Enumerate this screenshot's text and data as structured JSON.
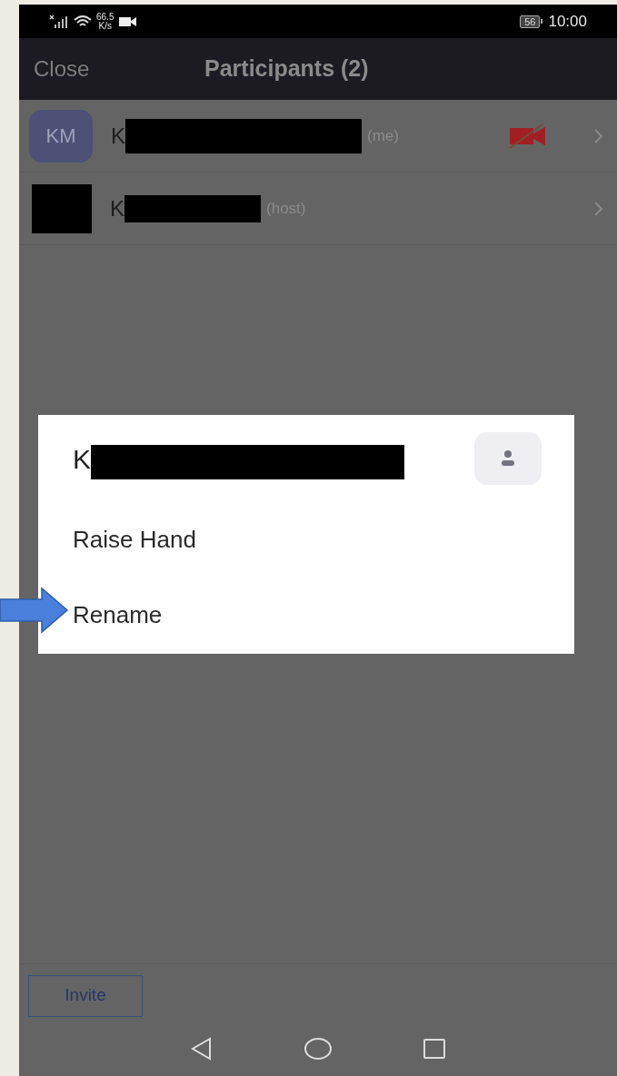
{
  "status_bar": {
    "speed_value": "66.5",
    "speed_unit": "K/s",
    "battery": "56",
    "time": "10:00"
  },
  "header": {
    "close": "Close",
    "title": "Participants (2)"
  },
  "participants": [
    {
      "avatar": {
        "kind": "initials",
        "text": "KM"
      },
      "name": "K",
      "tag": "(me)",
      "video_muted": true
    },
    {
      "avatar": {
        "kind": "redacted"
      },
      "name": "K",
      "tag": "(host)",
      "video_muted": false
    }
  ],
  "dialog": {
    "name": "K",
    "items": [
      "Raise Hand",
      "Rename"
    ]
  },
  "invite_button": "Invite"
}
